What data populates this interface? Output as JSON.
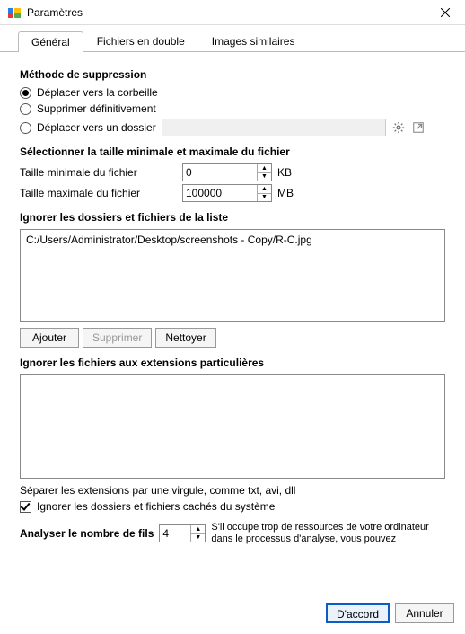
{
  "window": {
    "title": "Paramètres"
  },
  "tabs": {
    "general": "Général",
    "duplicates": "Fichiers en double",
    "images": "Images similaires"
  },
  "deletion": {
    "title": "Méthode de suppression",
    "recycle": "Déplacer vers la corbeille",
    "permanent": "Supprimer définitivement",
    "move_folder": "Déplacer vers un dossier"
  },
  "size": {
    "title": "Sélectionner la taille minimale et maximale du fichier",
    "min_label": "Taille minimale du fichier",
    "max_label": "Taille maximale du fichier",
    "min_value": "0",
    "max_value": "100000",
    "min_unit": "KB",
    "max_unit": "MB"
  },
  "ignore_list": {
    "title": "Ignorer les dossiers et fichiers de la liste",
    "items": [
      "C:/Users/Administrator/Desktop/screenshots - Copy/R-C.jpg"
    ],
    "add": "Ajouter",
    "remove": "Supprimer",
    "clear": "Nettoyer"
  },
  "ignore_ext": {
    "title": "Ignorer les fichiers aux extensions particulières",
    "hint": "Séparer les extensions par une virgule, comme txt, avi, dll"
  },
  "ignore_hidden": {
    "label": "Ignorer les dossiers et fichiers cachés du système"
  },
  "threads": {
    "label": "Analyser le nombre de fils",
    "value": "4",
    "hint": "S'il occupe trop de ressources de votre ordinateur dans le processus d'analyse, vous pouvez"
  },
  "buttons": {
    "ok": "D'accord",
    "cancel": "Annuler"
  },
  "icons": {
    "gear": "gear-icon",
    "open": "open-external-icon",
    "close": "close-icon"
  }
}
